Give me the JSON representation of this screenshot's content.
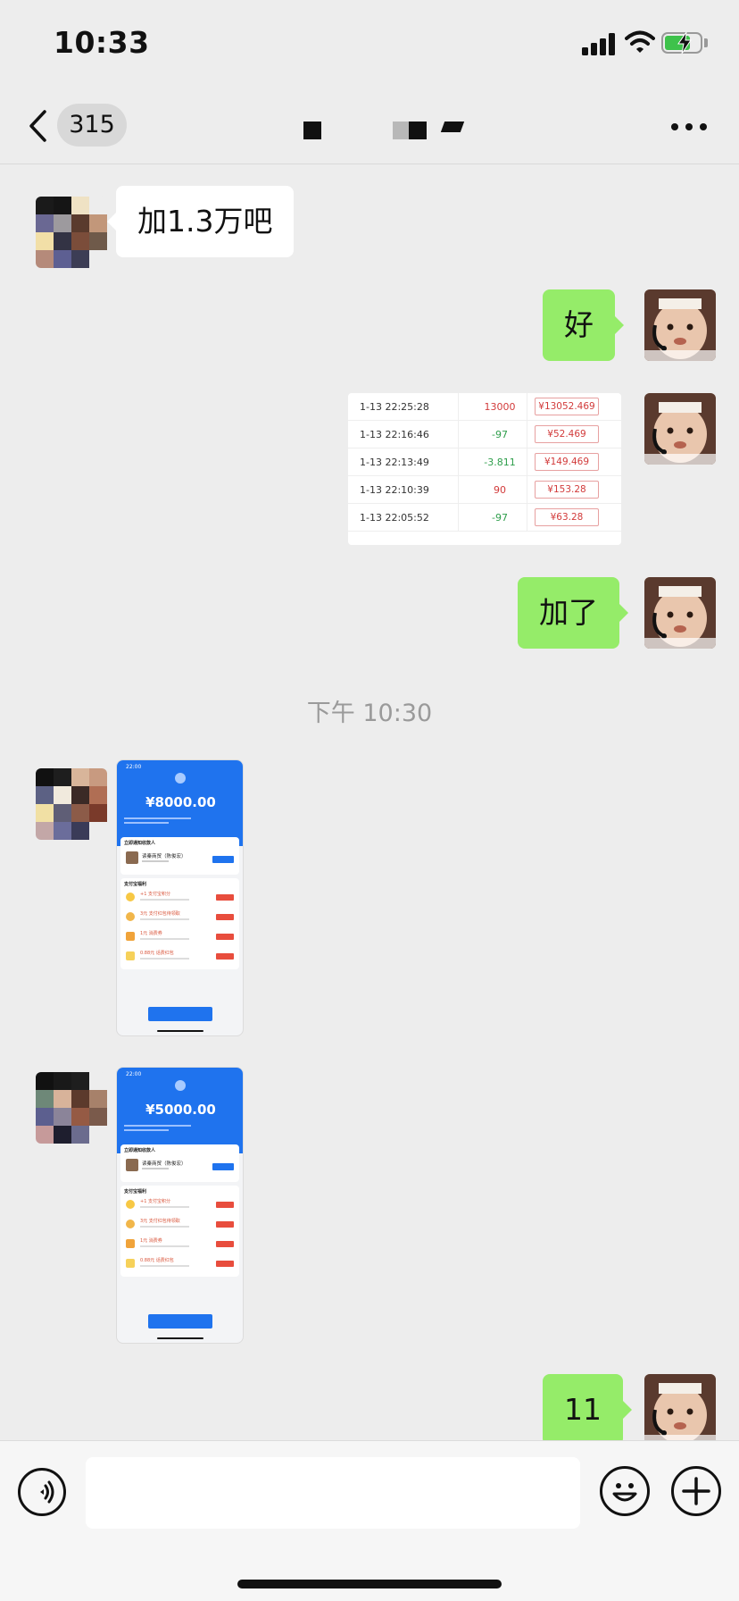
{
  "status_bar": {
    "time": "10:33"
  },
  "nav": {
    "unread_count": "315"
  },
  "messages": {
    "m1": {
      "text": "加1.3万吧"
    },
    "m2": {
      "text": "好"
    },
    "m3_table": {
      "rows": [
        {
          "time": "1-13 22:25:28",
          "amount": "13000",
          "balance": "¥13052.469"
        },
        {
          "time": "1-13 22:16:46",
          "amount": "-97",
          "balance": "¥52.469"
        },
        {
          "time": "1-13 22:13:49",
          "amount": "-3.811",
          "balance": "¥149.469"
        },
        {
          "time": "1-13 22:10:39",
          "amount": "90",
          "balance": "¥153.28"
        },
        {
          "time": "1-13 22:05:52",
          "amount": "-97",
          "balance": "¥63.28"
        }
      ]
    },
    "m4": {
      "text": "加了"
    },
    "time_divider": "下午 10:30",
    "receipt1": {
      "status_time": "22:00",
      "amount": "¥8000.00",
      "card_title": "立即通知收款人",
      "merchant": "读秦商贸（陈俊宏）",
      "perks_title": "支付宝福利",
      "perks": [
        "+1 支付宝积分",
        "3元 支付红包待领取",
        "1元 消费券",
        "0.88元 话费红包"
      ],
      "done": "完成"
    },
    "receipt2": {
      "status_time": "22:00",
      "amount": "¥5000.00",
      "card_title": "立即通知收款人",
      "merchant": "读秦商贸（陈俊宏）",
      "perks_title": "支付宝福利",
      "perks": [
        "+1 支付宝积分",
        "3元 支付红包待领取",
        "1元 消费券",
        "0.88元 话费红包"
      ],
      "done": "完成"
    },
    "m5": {
      "text": "11"
    }
  },
  "input_bar": {
    "placeholder": ""
  },
  "colors": {
    "outgoing_bubble": "#95ec69",
    "incoming_bubble": "#ffffff",
    "background": "#ededed",
    "alipay_blue": "#1f73ee"
  },
  "icons": [
    "back-icon",
    "signal-icon",
    "wifi-icon",
    "battery-icon",
    "more-icon",
    "voice-icon",
    "emoji-icon",
    "plus-icon"
  ]
}
